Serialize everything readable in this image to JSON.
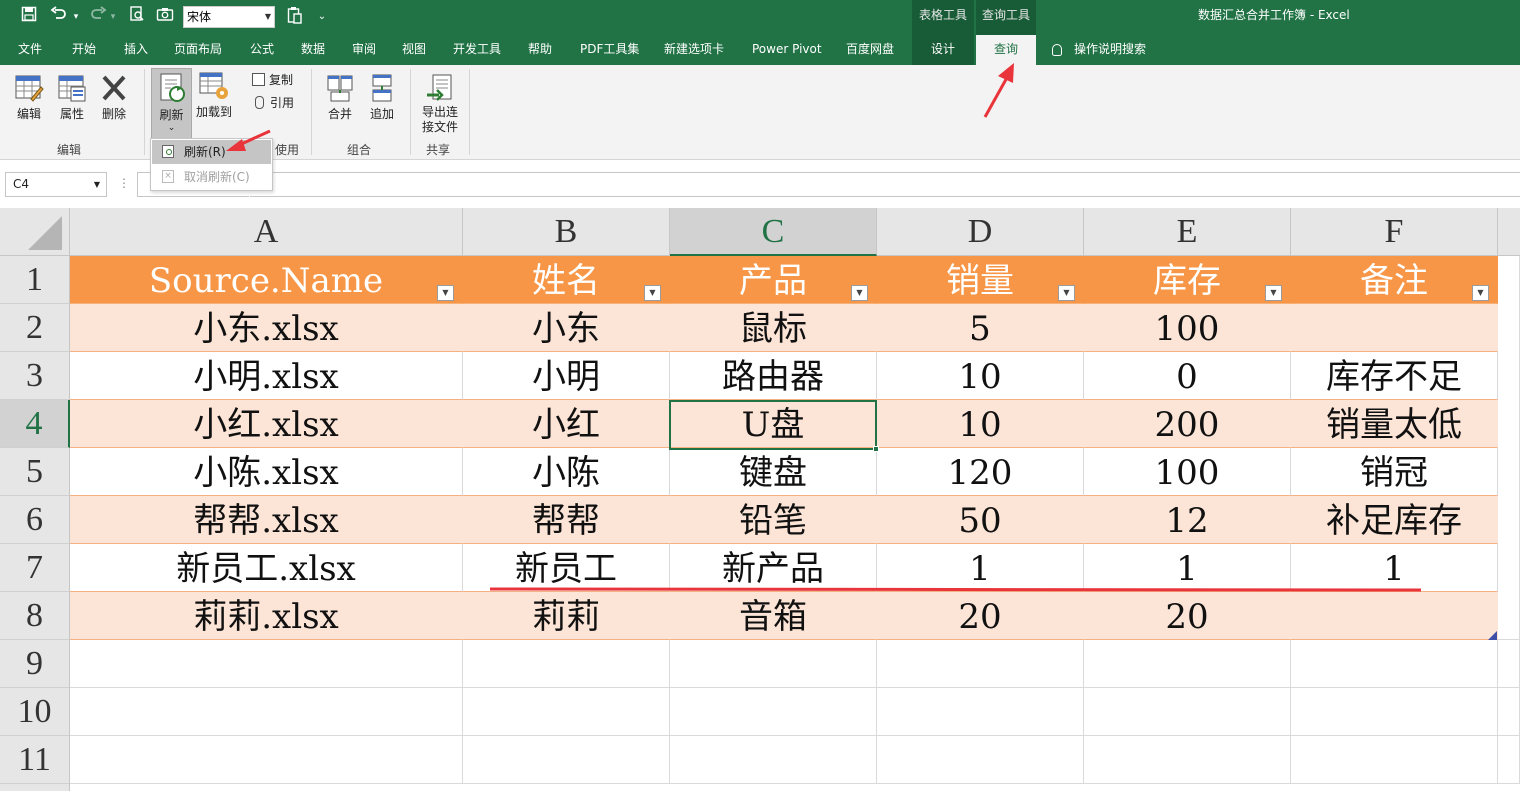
{
  "window": {
    "title": "数据汇总合并工作簿 - Excel",
    "font_name": "宋体",
    "context_groups": [
      "表格工具",
      "查询工具"
    ]
  },
  "tabs": [
    "文件",
    "开始",
    "插入",
    "页面布局",
    "公式",
    "数据",
    "审阅",
    "视图",
    "开发工具",
    "帮助",
    "PDF工具集",
    "新建选项卡",
    "Power Pivot",
    "百度网盘",
    "设计",
    "查询"
  ],
  "tell_me": "操作说明搜索",
  "ribbon": {
    "edit_group": {
      "label": "编辑",
      "buttons": [
        "编辑",
        "属性",
        "删除"
      ]
    },
    "use_group": {
      "label": "使用",
      "buttons": [
        "刷新",
        "加载到"
      ],
      "small": [
        "复制",
        "引用"
      ]
    },
    "combine_group": {
      "label": "组合",
      "buttons": [
        "合并",
        "追加"
      ]
    },
    "share_group": {
      "label": "共享",
      "button": "导出连接文件"
    }
  },
  "refresh_menu": {
    "items": [
      "刷新(R)",
      "取消刷新(C)"
    ]
  },
  "name_box": "C4",
  "grid": {
    "columns": [
      "A",
      "B",
      "C",
      "D",
      "E",
      "F"
    ],
    "selected_column": "C",
    "row_numbers": [
      "1",
      "2",
      "3",
      "4",
      "5",
      "6",
      "7",
      "8",
      "9",
      "10",
      "11"
    ],
    "selected_row": "4",
    "headers": [
      "Source.Name",
      "姓名",
      "产品",
      "销量",
      "库存",
      "备注"
    ],
    "rows": [
      [
        "小东.xlsx",
        "小东",
        "鼠标",
        "5",
        "100",
        ""
      ],
      [
        "小明.xlsx",
        "小明",
        "路由器",
        "10",
        "0",
        "库存不足"
      ],
      [
        "小红.xlsx",
        "小红",
        "U盘",
        "10",
        "200",
        "销量太低"
      ],
      [
        "小陈.xlsx",
        "小陈",
        "键盘",
        "120",
        "100",
        "销冠"
      ],
      [
        "帮帮.xlsx",
        "帮帮",
        "铅笔",
        "50",
        "12",
        "补足库存"
      ],
      [
        "新员工.xlsx",
        "新员工",
        "新产品",
        "1",
        "1",
        "1"
      ],
      [
        "莉莉.xlsx",
        "莉莉",
        "音箱",
        "20",
        "20",
        ""
      ]
    ]
  },
  "colors": {
    "excel_green": "#217346",
    "table_header": "#f79646",
    "table_band": "#fce4d6",
    "annotation_red": "#e8343a"
  }
}
